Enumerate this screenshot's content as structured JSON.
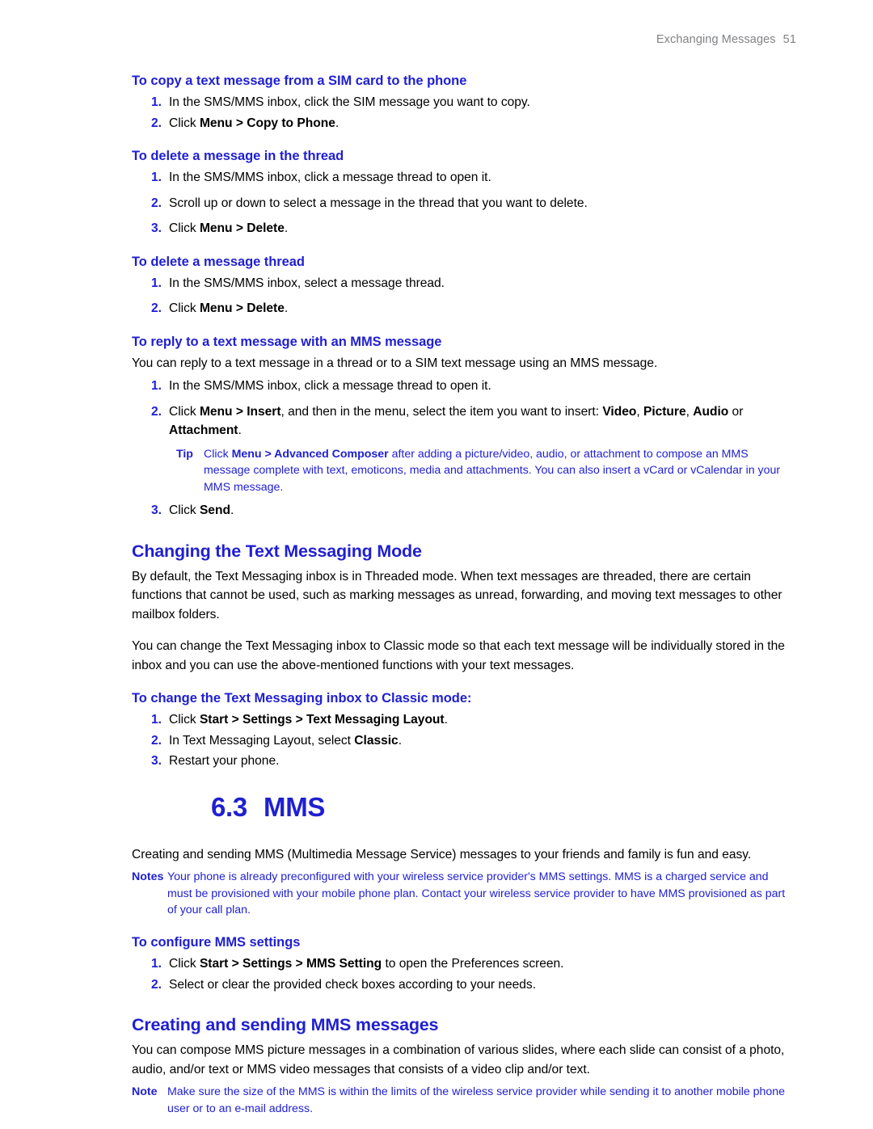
{
  "header": {
    "title": "Exchanging Messages",
    "page_number": "51"
  },
  "colors": {
    "heading_blue": "#1f1fd1",
    "body_black": "#000000",
    "header_gray": "#808285"
  },
  "blocks": [
    {
      "type": "sub-head",
      "name": "heading-copy-sim-message",
      "text": "To copy a text message from a SIM card to the phone"
    },
    {
      "type": "steps",
      "name": "steps-copy-sim-message",
      "tight": true,
      "items": [
        {
          "mark": "1.",
          "runs": [
            {
              "t": "In the SMS/MMS inbox, click the SIM message you want to copy."
            }
          ]
        },
        {
          "mark": "2.",
          "runs": [
            {
              "t": "Click "
            },
            {
              "t": "Menu > Copy to Phone",
              "b": true
            },
            {
              "t": "."
            }
          ]
        }
      ]
    },
    {
      "type": "sub-head",
      "gap": true,
      "name": "heading-delete-message-in-thread",
      "text": "To delete a message in the thread"
    },
    {
      "type": "steps",
      "name": "steps-delete-message-in-thread",
      "items": [
        {
          "mark": "1.",
          "runs": [
            {
              "t": "In the SMS/MMS inbox, click a message thread to open it."
            }
          ]
        },
        {
          "mark": "2.",
          "runs": [
            {
              "t": "Scroll up or down to select a message in the thread that you want to delete."
            }
          ]
        },
        {
          "mark": "3.",
          "runs": [
            {
              "t": "Click "
            },
            {
              "t": "Menu > Delete",
              "b": true
            },
            {
              "t": "."
            }
          ]
        }
      ]
    },
    {
      "type": "sub-head",
      "gap": true,
      "name": "heading-delete-message-thread",
      "text": "To delete a message thread"
    },
    {
      "type": "steps",
      "name": "steps-delete-message-thread",
      "items": [
        {
          "mark": "1.",
          "runs": [
            {
              "t": "In the SMS/MMS inbox, select a message thread."
            }
          ]
        },
        {
          "mark": "2.",
          "runs": [
            {
              "t": "Click "
            },
            {
              "t": "Menu > Delete",
              "b": true
            },
            {
              "t": "."
            }
          ]
        }
      ]
    },
    {
      "type": "sub-head",
      "gap": true,
      "name": "heading-reply-with-mms",
      "text": "To reply to a text message with an MMS message"
    },
    {
      "type": "para",
      "name": "paragraph-reply-with-mms-intro",
      "runs": [
        {
          "t": "You can reply to a text message in a thread or to a SIM text message using an MMS message."
        }
      ]
    },
    {
      "type": "steps",
      "name": "steps-reply-with-mms-part1",
      "items": [
        {
          "mark": "1.",
          "runs": [
            {
              "t": "In the SMS/MMS inbox, click a message thread to open it."
            }
          ]
        },
        {
          "mark": "2.",
          "runs": [
            {
              "t": "Click "
            },
            {
              "t": "Menu > Insert",
              "b": true
            },
            {
              "t": ", and then in the menu, select the item you want to insert: "
            },
            {
              "t": "Video",
              "b": true
            },
            {
              "t": ", "
            },
            {
              "t": "Picture",
              "b": true
            },
            {
              "t": ", "
            },
            {
              "t": "Audio",
              "b": true
            },
            {
              "t": " or "
            },
            {
              "t": "Attachment",
              "b": true
            },
            {
              "t": "."
            }
          ]
        }
      ]
    },
    {
      "type": "callout",
      "variant": "tip",
      "name": "callout-tip-advanced-composer",
      "label": "Tip",
      "runs": [
        {
          "t": "Click "
        },
        {
          "t": "Menu > Advanced Composer",
          "b": true
        },
        {
          "t": " after adding a picture/video, audio, or attachment to compose an MMS message complete with text, emoticons, media and attachments. You can also insert a vCard or vCalendar in your MMS message."
        }
      ]
    },
    {
      "type": "steps",
      "name": "steps-reply-with-mms-part2",
      "items": [
        {
          "mark": "3.",
          "runs": [
            {
              "t": "Click "
            },
            {
              "t": "Send",
              "b": true
            },
            {
              "t": "."
            }
          ]
        }
      ]
    },
    {
      "type": "sec-head",
      "gap": true,
      "name": "heading-changing-text-messaging-mode",
      "text": "Changing the Text Messaging Mode"
    },
    {
      "type": "para",
      "name": "paragraph-threaded-mode",
      "runs": [
        {
          "t": "By default, the Text Messaging inbox is in Threaded mode. When text messages are threaded, there are certain functions that cannot be used, such as marking messages as unread, forwarding, and moving text messages to other mailbox folders."
        }
      ]
    },
    {
      "type": "para",
      "gap": true,
      "name": "paragraph-classic-mode",
      "runs": [
        {
          "t": "You can change the Text Messaging inbox to Classic mode so that each text message will be individually stored in the inbox and you can use the above-mentioned functions with your text messages."
        }
      ]
    },
    {
      "type": "sub-head",
      "gap": true,
      "name": "heading-change-to-classic-mode",
      "text": "To change the Text Messaging inbox to Classic mode:"
    },
    {
      "type": "steps",
      "name": "steps-change-to-classic-mode",
      "tight": true,
      "items": [
        {
          "mark": "1.",
          "runs": [
            {
              "t": "Click "
            },
            {
              "t": "Start > Settings > Text Messaging Layout",
              "b": true
            },
            {
              "t": "."
            }
          ]
        },
        {
          "mark": "2.",
          "runs": [
            {
              "t": "In Text Messaging Layout, select "
            },
            {
              "t": "Classic",
              "b": true
            },
            {
              "t": "."
            }
          ]
        },
        {
          "mark": "3.",
          "runs": [
            {
              "t": "Restart your phone."
            }
          ]
        }
      ]
    },
    {
      "type": "chapter-head",
      "name": "heading-chapter-6-3-mms",
      "number": "6.3",
      "text": "MMS"
    },
    {
      "type": "para",
      "name": "paragraph-mms-intro",
      "runs": [
        {
          "t": "Creating and sending MMS (Multimedia Message Service) messages to your friends and family is fun and easy."
        }
      ]
    },
    {
      "type": "callout",
      "variant": "notes",
      "name": "callout-notes-mms-preconfigured",
      "label": "Notes",
      "runs": [
        {
          "t": "Your phone is already preconfigured with your wireless service provider's MMS settings. MMS is a charged service and must be provisioned with your mobile phone plan. Contact your wireless service provider to have MMS provisioned as part of your call plan."
        }
      ]
    },
    {
      "type": "sub-head",
      "gap": true,
      "name": "heading-configure-mms-settings",
      "text": "To configure MMS settings"
    },
    {
      "type": "steps",
      "name": "steps-configure-mms-settings",
      "tight": true,
      "items": [
        {
          "mark": "1.",
          "runs": [
            {
              "t": "Click "
            },
            {
              "t": "Start > Settings > MMS Setting",
              "b": true
            },
            {
              "t": " to open the Preferences screen."
            }
          ]
        },
        {
          "mark": "2.",
          "runs": [
            {
              "t": "Select or clear the provided check boxes according to your needs."
            }
          ]
        }
      ]
    },
    {
      "type": "sec-head",
      "gap": true,
      "name": "heading-creating-sending-mms-messages",
      "text": "Creating and sending MMS messages"
    },
    {
      "type": "para",
      "name": "paragraph-compose-mms",
      "runs": [
        {
          "t": "You can compose MMS picture messages in a combination of various slides, where each slide can consist of a photo, audio, and/or text or MMS video messages that consists of a video clip and/or text."
        }
      ]
    },
    {
      "type": "callout",
      "variant": "note",
      "name": "callout-note-mms-size-limit",
      "label": "Note",
      "runs": [
        {
          "t": "Make sure the size of the MMS is within the limits of the wireless service provider while sending it to another mobile phone user or to an e-mail address."
        }
      ]
    }
  ]
}
